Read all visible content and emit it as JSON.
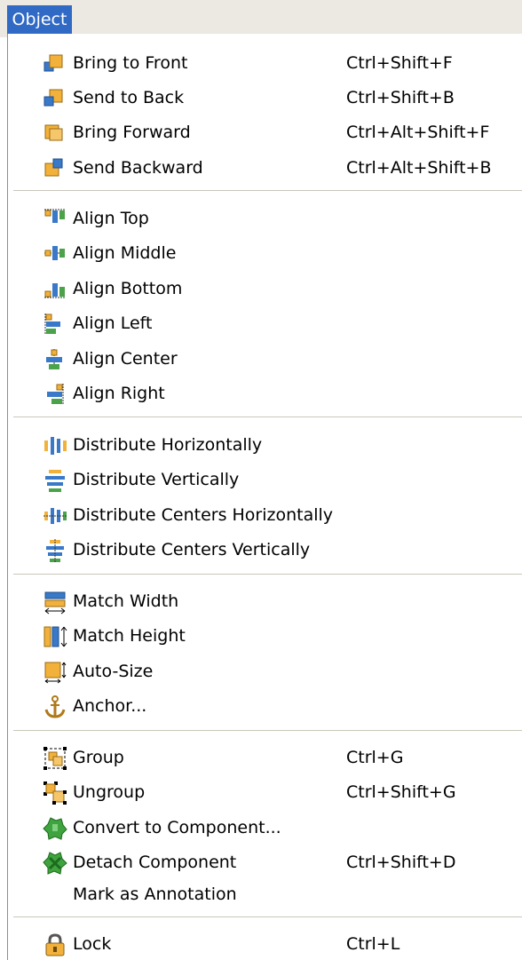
{
  "menu_title": "Object",
  "items": [
    {
      "label": "Bring to Front",
      "shortcut": "Ctrl+Shift+F",
      "icon": "bring-to-front-icon"
    },
    {
      "label": "Send to Back",
      "shortcut": "Ctrl+Shift+B",
      "icon": "send-to-back-icon"
    },
    {
      "label": "Bring Forward",
      "shortcut": "Ctrl+Alt+Shift+F",
      "icon": "bring-forward-icon"
    },
    {
      "label": "Send Backward",
      "shortcut": "Ctrl+Alt+Shift+B",
      "icon": "send-backward-icon"
    },
    {
      "label": "Align Top",
      "icon": "align-top-icon"
    },
    {
      "label": "Align Middle",
      "icon": "align-middle-icon"
    },
    {
      "label": "Align Bottom",
      "icon": "align-bottom-icon"
    },
    {
      "label": "Align Left",
      "icon": "align-left-icon"
    },
    {
      "label": "Align Center",
      "icon": "align-center-icon"
    },
    {
      "label": "Align Right",
      "icon": "align-right-icon"
    },
    {
      "label": "Distribute Horizontally",
      "icon": "distribute-horizontally-icon"
    },
    {
      "label": "Distribute Vertically",
      "icon": "distribute-vertically-icon"
    },
    {
      "label": "Distribute Centers Horizontally",
      "icon": "distribute-centers-horizontally-icon"
    },
    {
      "label": "Distribute Centers Vertically",
      "icon": "distribute-centers-vertically-icon"
    },
    {
      "label": "Match Width",
      "icon": "match-width-icon"
    },
    {
      "label": "Match Height",
      "icon": "match-height-icon"
    },
    {
      "label": "Auto-Size",
      "icon": "auto-size-icon"
    },
    {
      "label": "Anchor...",
      "icon": "anchor-icon"
    },
    {
      "label": "Group",
      "shortcut": "Ctrl+G",
      "icon": "group-icon"
    },
    {
      "label": "Ungroup",
      "shortcut": "Ctrl+Shift+G",
      "icon": "ungroup-icon"
    },
    {
      "label": "Convert to Component...",
      "icon": "convert-to-component-icon"
    },
    {
      "label": "Detach Component",
      "shortcut": "Ctrl+Shift+D",
      "icon": "detach-component-icon"
    },
    {
      "label": "Mark as Annotation"
    },
    {
      "label": "Lock",
      "shortcut": "Ctrl+L",
      "icon": "lock-icon"
    }
  ],
  "colors": {
    "highlight": "#316ac5",
    "square_orange": "#f2b13b",
    "square_blue": "#3a79c8",
    "square_green": "#4aa24a",
    "separator": "#c9c7ba"
  }
}
